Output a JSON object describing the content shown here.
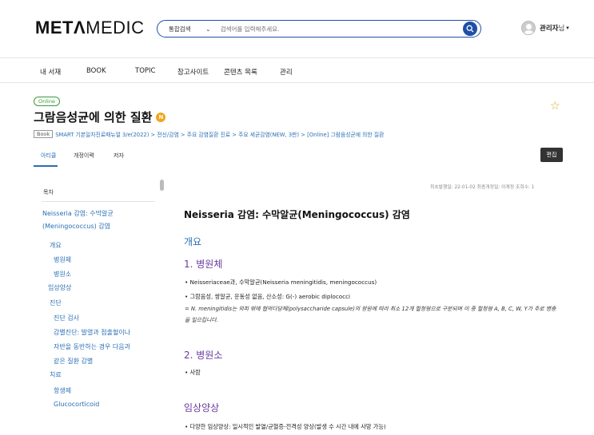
{
  "header": {
    "logo_bold": "METΛ",
    "logo_light": "MEDIC",
    "search_scope": "통합검색",
    "search_placeholder": "검색어를 입력해주세요.",
    "user_name": "관리자",
    "user_suffix": "님",
    "user_caret": "▾"
  },
  "nav": {
    "items": [
      "내 서재",
      "BOOK",
      "TOPIC",
      "참고사이트",
      "콘텐츠 목록",
      "관리"
    ]
  },
  "page": {
    "status_badge": "Online",
    "title": "그람음성균에 의한 질환",
    "title_badge": "N",
    "book_tag": "Book",
    "breadcrumb": "SMART 기본일차진료매뉴얼 3/e(2022) > 전신/감염 > 주요 감염질환 진료 > 주요 세균감염(NEW, 3판) > [Online] 그람음성균에 의한 질환",
    "tabs": [
      "아티클",
      "개정이력",
      "저자"
    ],
    "edit_label": "편집"
  },
  "toc": {
    "title": "목차",
    "items": [
      "Neisseria 감염: 수막알균(Meningococcus) 감염",
      "개요",
      "병원체",
      "병원소",
      "임상양상",
      "진단",
      "진단 검사",
      "감별진단: 발열과 점출혈이나",
      "자반을 동반하는 경우 다음과",
      "같은 질환 감별",
      "치료",
      "항생제",
      "Glucocorticoid"
    ]
  },
  "content": {
    "meta": "최초발행일: 22-01-02   최종개정일: 이계정   조회수: 1",
    "heading": "Neisseria 감염: 수막알균(Meningococcus) 감염",
    "overview": "개요",
    "section1_title": "1. 병원체",
    "section1_bullets": [
      "Neisseriaceae과, 수막알균(Neisseria meningitidis, meningococcus)",
      "그람음성, 쌍알균, 운동성 없음, 산소성: G(-) aerobic diplococci"
    ],
    "section1_note": "= N. meningitidis는 외피 밖에 협막다당체(polysaccharide capsule)의 항원에 따라 최소 12개 혈청형으로 구분되며 이 중 혈청형 A, B, C, W, Y가 주로 병증을 일으킵니다.",
    "section2_title": "2. 병원소",
    "section2_bullets": [
      "사람"
    ],
    "section3_title": "임상양상",
    "section3_bullets": [
      "다양한 임상양상: 일시적인 발열/균혈증-전격성 양상(발생 수 시간 내에 사망 가능)"
    ]
  },
  "colors": {
    "accent": "#2a6fb5",
    "brand_blue": "#1f4fa8",
    "section_purple": "#6a3aa0",
    "badge_orange": "#f2a51a",
    "online_green": "#3a9a3a"
  },
  "icons": [
    "search-icon",
    "user-avatar-icon",
    "star-icon",
    "n-badge-icon"
  ]
}
